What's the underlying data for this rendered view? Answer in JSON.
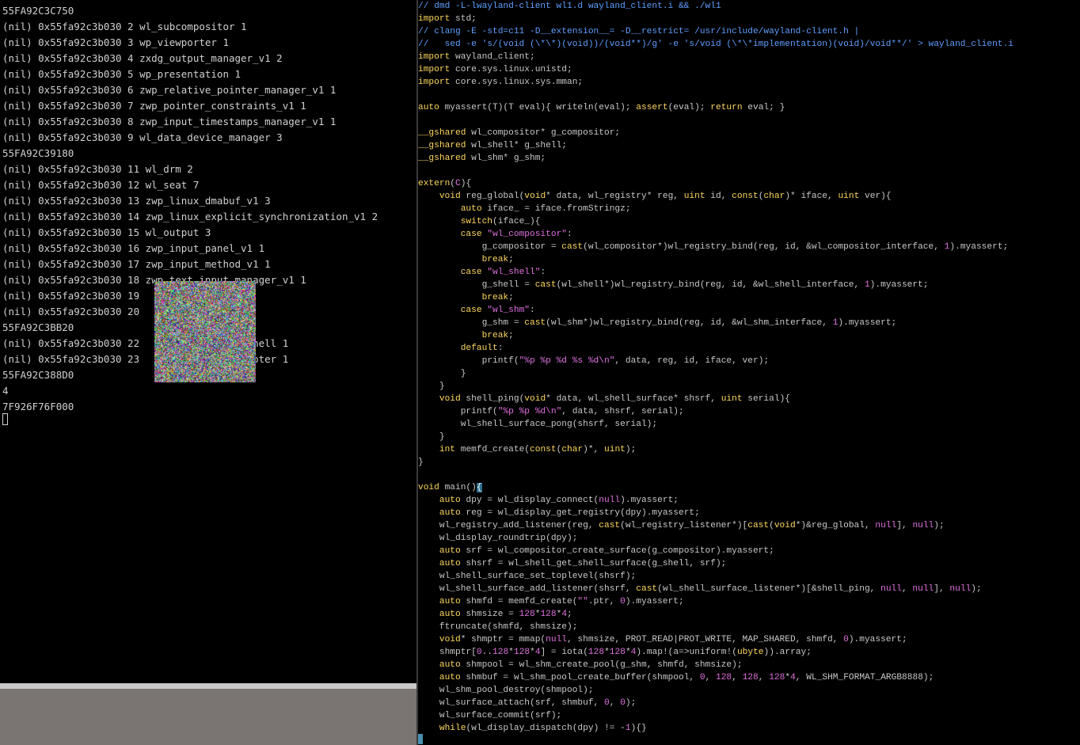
{
  "terminal": {
    "lines": [
      "55FA92C3C750",
      "(nil) 0x55fa92c3b030 2 wl_subcompositor 1",
      "(nil) 0x55fa92c3b030 3 wp_viewporter 1",
      "(nil) 0x55fa92c3b030 4 zxdg_output_manager_v1 2",
      "(nil) 0x55fa92c3b030 5 wp_presentation 1",
      "(nil) 0x55fa92c3b030 6 zwp_relative_pointer_manager_v1 1",
      "(nil) 0x55fa92c3b030 7 zwp_pointer_constraints_v1 1",
      "(nil) 0x55fa92c3b030 8 zwp_input_timestamps_manager_v1 1",
      "(nil) 0x55fa92c3b030 9 wl_data_device_manager 3",
      "55FA92C39180",
      "(nil) 0x55fa92c3b030 11 wl_drm 2",
      "(nil) 0x55fa92c3b030 12 wl_seat 7",
      "(nil) 0x55fa92c3b030 13 zwp_linux_dmabuf_v1 3",
      "(nil) 0x55fa92c3b030 14 zwp_linux_explicit_synchronization_v1 2",
      "(nil) 0x55fa92c3b030 15 wl_output 3",
      "(nil) 0x55fa92c3b030 16 zwp_input_panel_v1 1",
      "(nil) 0x55fa92c3b030 17 zwp_input_method_v1 1",
      "(nil) 0x55fa92c3b030 18 zwp_text_input_manager_v1 1",
      "(nil) 0x55fa92c3b030 19",
      "(nil) 0x55fa92c3b030 20",
      "55FA92C3BB20",
      "(nil) 0x55fa92c3b030 22                  shell 1",
      "(nil) 0x55fa92c3b030 23                  ooter 1",
      "55FA92C388D0",
      "4",
      "7F926F76F000"
    ]
  },
  "editor": {
    "lines": [
      [
        [
          "c",
          "// dmd -L-lwayland-client wl1.d wayland_client.i && ./wl1"
        ]
      ],
      [
        [
          "k",
          "import"
        ],
        [
          "t",
          " std;"
        ]
      ],
      [
        [
          "c",
          "// clang -E -std=c11 -D__extension__= -D__restrict= /usr/include/wayland-client.h |"
        ]
      ],
      [
        [
          "c",
          "//   sed -e 's/(void (\\*\\*)(void))/(void**)/g' -e 's/void (\\*\\*implementation)(void)/void**/' > wayland_client.i"
        ]
      ],
      [
        [
          "k",
          "import"
        ],
        [
          "t",
          " wayland_client;"
        ]
      ],
      [
        [
          "k",
          "import"
        ],
        [
          "t",
          " core.sys.linux.unistd;"
        ]
      ],
      [
        [
          "k",
          "import"
        ],
        [
          "t",
          " core.sys.linux.sys.mman;"
        ]
      ],
      [
        [
          "t",
          ""
        ]
      ],
      [
        [
          "k",
          "auto"
        ],
        [
          "t",
          " myassert(T)(T eval){ writeln(eval); "
        ],
        [
          "k",
          "assert"
        ],
        [
          "t",
          "(eval); "
        ],
        [
          "k",
          "return"
        ],
        [
          "t",
          " eval; }"
        ]
      ],
      [
        [
          "t",
          ""
        ]
      ],
      [
        [
          "k",
          "__gshared"
        ],
        [
          "t",
          " wl_compositor* g_compositor;"
        ]
      ],
      [
        [
          "k",
          "__gshared"
        ],
        [
          "t",
          " wl_shell* g_shell;"
        ]
      ],
      [
        [
          "k",
          "__gshared"
        ],
        [
          "t",
          " wl_shm* g_shm;"
        ]
      ],
      [
        [
          "t",
          ""
        ]
      ],
      [
        [
          "k",
          "extern"
        ],
        [
          "t",
          "("
        ],
        [
          "n",
          "C"
        ],
        [
          "t",
          "){"
        ]
      ],
      [
        [
          "t",
          "    "
        ],
        [
          "k",
          "void"
        ],
        [
          "t",
          " reg_global("
        ],
        [
          "k",
          "void"
        ],
        [
          "t",
          "* data, wl_registry* reg, "
        ],
        [
          "k",
          "uint"
        ],
        [
          "t",
          " id, "
        ],
        [
          "k",
          "const"
        ],
        [
          "t",
          "("
        ],
        [
          "k",
          "char"
        ],
        [
          "t",
          ")* iface, "
        ],
        [
          "k",
          "uint"
        ],
        [
          "t",
          " ver){"
        ]
      ],
      [
        [
          "t",
          "        "
        ],
        [
          "k",
          "auto"
        ],
        [
          "t",
          " iface_ = iface.fromStringz;"
        ]
      ],
      [
        [
          "t",
          "        "
        ],
        [
          "k",
          "switch"
        ],
        [
          "t",
          "(iface_){"
        ]
      ],
      [
        [
          "t",
          "        "
        ],
        [
          "k",
          "case"
        ],
        [
          "t",
          " "
        ],
        [
          "s",
          "\"wl_compositor\""
        ],
        [
          "t",
          ":"
        ]
      ],
      [
        [
          "t",
          "            g_compositor = "
        ],
        [
          "k",
          "cast"
        ],
        [
          "t",
          "(wl_compositor*)wl_registry_bind(reg, id, &wl_compositor_interface, "
        ],
        [
          "n",
          "1"
        ],
        [
          "t",
          ").myassert;"
        ]
      ],
      [
        [
          "t",
          "            "
        ],
        [
          "k",
          "break"
        ],
        [
          "t",
          ";"
        ]
      ],
      [
        [
          "t",
          "        "
        ],
        [
          "k",
          "case"
        ],
        [
          "t",
          " "
        ],
        [
          "s",
          "\"wl_shell\""
        ],
        [
          "t",
          ":"
        ]
      ],
      [
        [
          "t",
          "            g_shell = "
        ],
        [
          "k",
          "cast"
        ],
        [
          "t",
          "(wl_shell*)wl_registry_bind(reg, id, &wl_shell_interface, "
        ],
        [
          "n",
          "1"
        ],
        [
          "t",
          ").myassert;"
        ]
      ],
      [
        [
          "t",
          "            "
        ],
        [
          "k",
          "break"
        ],
        [
          "t",
          ";"
        ]
      ],
      [
        [
          "t",
          "        "
        ],
        [
          "k",
          "case"
        ],
        [
          "t",
          " "
        ],
        [
          "s",
          "\"wl_shm\""
        ],
        [
          "t",
          ":"
        ]
      ],
      [
        [
          "t",
          "            g_shm = "
        ],
        [
          "k",
          "cast"
        ],
        [
          "t",
          "(wl_shm*)wl_registry_bind(reg, id, &wl_shm_interface, "
        ],
        [
          "n",
          "1"
        ],
        [
          "t",
          ").myassert;"
        ]
      ],
      [
        [
          "t",
          "            "
        ],
        [
          "k",
          "break"
        ],
        [
          "t",
          ";"
        ]
      ],
      [
        [
          "t",
          "        "
        ],
        [
          "k",
          "default"
        ],
        [
          "t",
          ":"
        ]
      ],
      [
        [
          "t",
          "            printf("
        ],
        [
          "s",
          "\"%p %p %d %s %d\\n\""
        ],
        [
          "t",
          ", data, reg, id, iface, ver);"
        ]
      ],
      [
        [
          "t",
          "        }"
        ]
      ],
      [
        [
          "t",
          "    }"
        ]
      ],
      [
        [
          "t",
          "    "
        ],
        [
          "k",
          "void"
        ],
        [
          "t",
          " shell_ping("
        ],
        [
          "k",
          "void"
        ],
        [
          "t",
          "* data, wl_shell_surface* shsrf, "
        ],
        [
          "k",
          "uint"
        ],
        [
          "t",
          " serial){"
        ]
      ],
      [
        [
          "t",
          "        printf("
        ],
        [
          "s",
          "\"%p %p %d\\n\""
        ],
        [
          "t",
          ", data, shsrf, serial);"
        ]
      ],
      [
        [
          "t",
          "        wl_shell_surface_pong(shsrf, serial);"
        ]
      ],
      [
        [
          "t",
          "    }"
        ]
      ],
      [
        [
          "t",
          "    "
        ],
        [
          "k",
          "int"
        ],
        [
          "t",
          " memfd_create("
        ],
        [
          "k",
          "const"
        ],
        [
          "t",
          "("
        ],
        [
          "k",
          "char"
        ],
        [
          "t",
          ")*, "
        ],
        [
          "k",
          "uint"
        ],
        [
          "t",
          ");"
        ]
      ],
      [
        [
          "t",
          "}"
        ]
      ],
      [
        [
          "t",
          ""
        ]
      ],
      [
        [
          "k",
          "void"
        ],
        [
          "t",
          " main()"
        ],
        [
          "h",
          "{"
        ]
      ],
      [
        [
          "t",
          "    "
        ],
        [
          "k",
          "auto"
        ],
        [
          "t",
          " dpy = wl_display_connect("
        ],
        [
          "n",
          "null"
        ],
        [
          "t",
          ").myassert;"
        ]
      ],
      [
        [
          "t",
          "    "
        ],
        [
          "k",
          "auto"
        ],
        [
          "t",
          " reg = wl_display_get_registry(dpy).myassert;"
        ]
      ],
      [
        [
          "t",
          "    wl_registry_add_listener(reg, "
        ],
        [
          "k",
          "cast"
        ],
        [
          "t",
          "(wl_registry_listener*)["
        ],
        [
          "k",
          "cast"
        ],
        [
          "t",
          "("
        ],
        [
          "k",
          "void"
        ],
        [
          "t",
          "*)&reg_global, "
        ],
        [
          "n",
          "null"
        ],
        [
          "t",
          "], "
        ],
        [
          "n",
          "null"
        ],
        [
          "t",
          ");"
        ]
      ],
      [
        [
          "t",
          "    wl_display_roundtrip(dpy);"
        ]
      ],
      [
        [
          "t",
          "    "
        ],
        [
          "k",
          "auto"
        ],
        [
          "t",
          " srf = wl_compositor_create_surface(g_compositor).myassert;"
        ]
      ],
      [
        [
          "t",
          "    "
        ],
        [
          "k",
          "auto"
        ],
        [
          "t",
          " shsrf = wl_shell_get_shell_surface(g_shell, srf);"
        ]
      ],
      [
        [
          "t",
          "    wl_shell_surface_set_toplevel(shsrf);"
        ]
      ],
      [
        [
          "t",
          "    wl_shell_surface_add_listener(shsrf, "
        ],
        [
          "k",
          "cast"
        ],
        [
          "t",
          "(wl_shell_surface_listener*)[&shell_ping, "
        ],
        [
          "n",
          "null"
        ],
        [
          "t",
          ", "
        ],
        [
          "n",
          "null"
        ],
        [
          "t",
          "], "
        ],
        [
          "n",
          "null"
        ],
        [
          "t",
          ");"
        ]
      ],
      [
        [
          "t",
          "    "
        ],
        [
          "k",
          "auto"
        ],
        [
          "t",
          " shmfd = memfd_create("
        ],
        [
          "s",
          "\"\""
        ],
        [
          "t",
          ".ptr, "
        ],
        [
          "n",
          "0"
        ],
        [
          "t",
          ").myassert;"
        ]
      ],
      [
        [
          "t",
          "    "
        ],
        [
          "k",
          "auto"
        ],
        [
          "t",
          " shmsize = "
        ],
        [
          "n",
          "128"
        ],
        [
          "t",
          "*"
        ],
        [
          "n",
          "128"
        ],
        [
          "t",
          "*"
        ],
        [
          "n",
          "4"
        ],
        [
          "t",
          ";"
        ]
      ],
      [
        [
          "t",
          "    ftruncate(shmfd, shmsize);"
        ]
      ],
      [
        [
          "t",
          "    "
        ],
        [
          "k",
          "void"
        ],
        [
          "t",
          "* shmptr = mmap("
        ],
        [
          "n",
          "null"
        ],
        [
          "t",
          ", shmsize, PROT_READ|PROT_WRITE, MAP_SHARED, shmfd, "
        ],
        [
          "n",
          "0"
        ],
        [
          "t",
          ").myassert;"
        ]
      ],
      [
        [
          "t",
          "    shmptr["
        ],
        [
          "n",
          "0"
        ],
        [
          "t",
          ".."
        ],
        [
          "n",
          "128"
        ],
        [
          "t",
          "*"
        ],
        [
          "n",
          "128"
        ],
        [
          "t",
          "*"
        ],
        [
          "n",
          "4"
        ],
        [
          "t",
          "] = iota("
        ],
        [
          "n",
          "128"
        ],
        [
          "t",
          "*"
        ],
        [
          "n",
          "128"
        ],
        [
          "t",
          "*"
        ],
        [
          "n",
          "4"
        ],
        [
          "t",
          ").map!(a=>uniform!("
        ],
        [
          "k",
          "ubyte"
        ],
        [
          "t",
          ")).array;"
        ]
      ],
      [
        [
          "t",
          "    "
        ],
        [
          "k",
          "auto"
        ],
        [
          "t",
          " shmpool = wl_shm_create_pool(g_shm, shmfd, shmsize);"
        ]
      ],
      [
        [
          "t",
          "    "
        ],
        [
          "k",
          "auto"
        ],
        [
          "t",
          " shmbuf = wl_shm_pool_create_buffer(shmpool, "
        ],
        [
          "n",
          "0"
        ],
        [
          "t",
          ", "
        ],
        [
          "n",
          "128"
        ],
        [
          "t",
          ", "
        ],
        [
          "n",
          "128"
        ],
        [
          "t",
          ", "
        ],
        [
          "n",
          "128"
        ],
        [
          "t",
          "*"
        ],
        [
          "n",
          "4"
        ],
        [
          "t",
          ", WL_SHM_FORMAT_ARGB8888);"
        ]
      ],
      [
        [
          "t",
          "    wl_shm_pool_destroy(shmpool);"
        ]
      ],
      [
        [
          "t",
          "    wl_surface_attach(srf, shmbuf, "
        ],
        [
          "n",
          "0"
        ],
        [
          "t",
          ", "
        ],
        [
          "n",
          "0"
        ],
        [
          "t",
          ");"
        ]
      ],
      [
        [
          "t",
          "    wl_surface_commit(srf);"
        ]
      ],
      [
        [
          "t",
          "    "
        ],
        [
          "k",
          "while"
        ],
        [
          "t",
          "(wl_display_dispatch(dpy) != -"
        ],
        [
          "n",
          "1"
        ],
        [
          "t",
          "){}"
        ]
      ]
    ]
  }
}
